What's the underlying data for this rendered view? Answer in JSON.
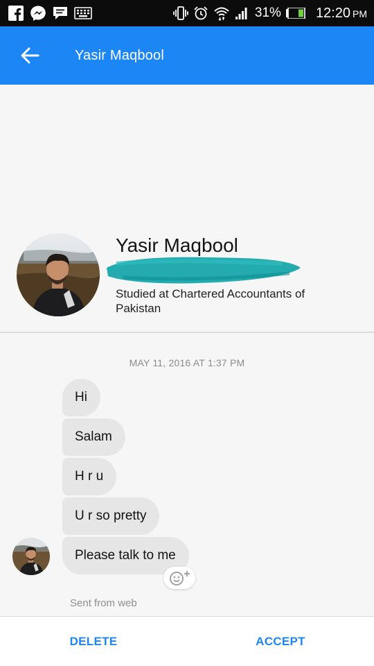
{
  "status_bar": {
    "battery": "31%",
    "time": "12:20",
    "am_pm": "PM",
    "left_icons": [
      "facebook-icon",
      "messenger-icon",
      "chat-notification-icon",
      "keyboard-icon"
    ],
    "right_icons": [
      "vibrate-icon",
      "alarm-icon",
      "wifi-icon",
      "signal-icon",
      "battery-icon"
    ]
  },
  "header": {
    "back_icon": "arrow-left-icon",
    "title": "Yasir Maqbool",
    "color": "#1c86f5"
  },
  "profile": {
    "name": "Yasir Maqbool",
    "subtitle": "Studied at Chartered Accountants of Pakistan",
    "redaction_color": "#1aa6ad"
  },
  "conversation": {
    "timestamp": "MAY 11, 2016 AT 1:37 PM",
    "messages": [
      {
        "text": "Hi"
      },
      {
        "text": "Salam"
      },
      {
        "text": "H r u"
      },
      {
        "text": "U r so pretty"
      },
      {
        "text": "Please talk to me"
      }
    ],
    "react_icon": "smiley-plus-icon",
    "sent_from": "Sent from web"
  },
  "actions": {
    "delete_label": "DELETE",
    "accept_label": "ACCEPT",
    "accent_color": "#1c86f5"
  }
}
